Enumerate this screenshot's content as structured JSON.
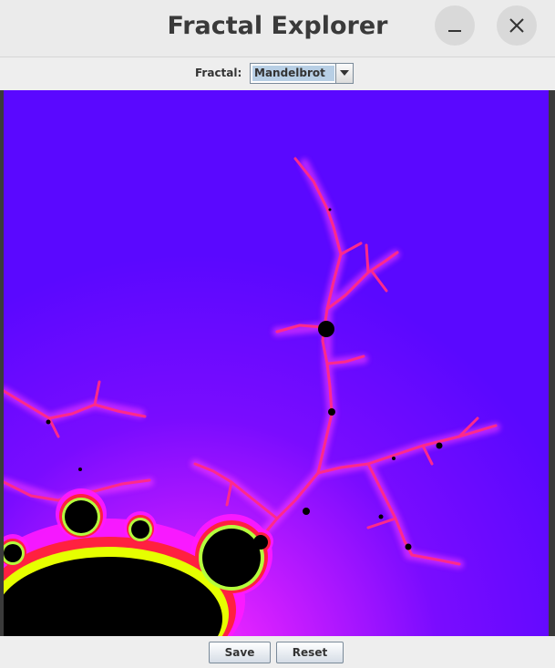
{
  "window": {
    "title": "Fractal Explorer"
  },
  "controls": {
    "fractal_label": "Fractal:",
    "fractal_selected": "Mandelbrot"
  },
  "buttons": {
    "save_label": "Save",
    "reset_label": "Reset"
  },
  "icons": {
    "minimize": "minimize-icon",
    "close": "close-icon",
    "dropdown": "chevron-down-icon"
  },
  "colors": {
    "fractal_background": "#5a08ff",
    "fractal_edge_glow": "#ff1aff",
    "fractal_filament": "#ff2a8a",
    "fractal_inner_band": "#ffff00",
    "fractal_set": "#000000"
  }
}
